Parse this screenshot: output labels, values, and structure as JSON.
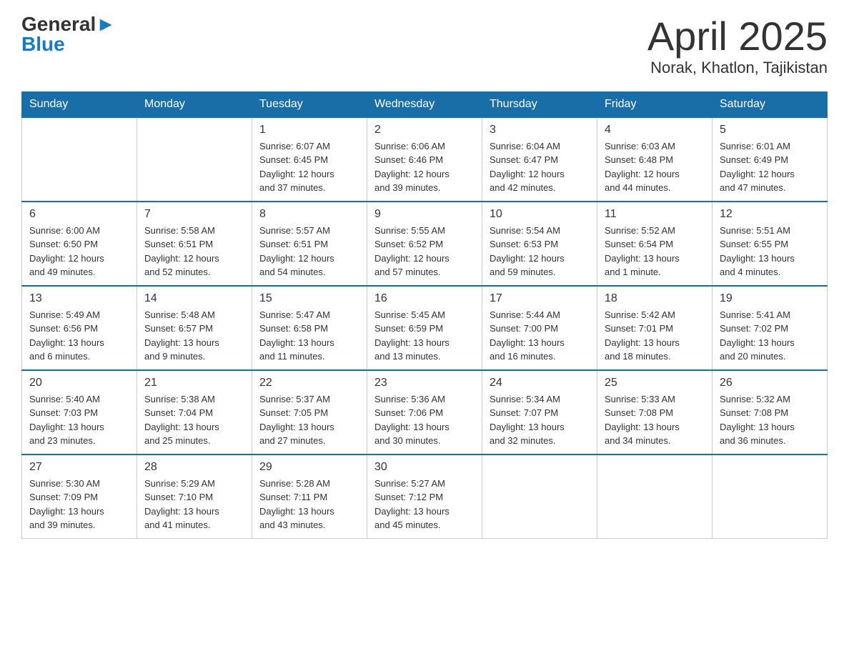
{
  "header": {
    "logo": {
      "line1": "General",
      "line2": "Blue",
      "arrow": "▶"
    },
    "month": "April 2025",
    "location": "Norak, Khatlon, Tajikistan"
  },
  "weekdays": [
    "Sunday",
    "Monday",
    "Tuesday",
    "Wednesday",
    "Thursday",
    "Friday",
    "Saturday"
  ],
  "weeks": [
    [
      {
        "day": "",
        "info": ""
      },
      {
        "day": "",
        "info": ""
      },
      {
        "day": "1",
        "info": "Sunrise: 6:07 AM\nSunset: 6:45 PM\nDaylight: 12 hours\nand 37 minutes."
      },
      {
        "day": "2",
        "info": "Sunrise: 6:06 AM\nSunset: 6:46 PM\nDaylight: 12 hours\nand 39 minutes."
      },
      {
        "day": "3",
        "info": "Sunrise: 6:04 AM\nSunset: 6:47 PM\nDaylight: 12 hours\nand 42 minutes."
      },
      {
        "day": "4",
        "info": "Sunrise: 6:03 AM\nSunset: 6:48 PM\nDaylight: 12 hours\nand 44 minutes."
      },
      {
        "day": "5",
        "info": "Sunrise: 6:01 AM\nSunset: 6:49 PM\nDaylight: 12 hours\nand 47 minutes."
      }
    ],
    [
      {
        "day": "6",
        "info": "Sunrise: 6:00 AM\nSunset: 6:50 PM\nDaylight: 12 hours\nand 49 minutes."
      },
      {
        "day": "7",
        "info": "Sunrise: 5:58 AM\nSunset: 6:51 PM\nDaylight: 12 hours\nand 52 minutes."
      },
      {
        "day": "8",
        "info": "Sunrise: 5:57 AM\nSunset: 6:51 PM\nDaylight: 12 hours\nand 54 minutes."
      },
      {
        "day": "9",
        "info": "Sunrise: 5:55 AM\nSunset: 6:52 PM\nDaylight: 12 hours\nand 57 minutes."
      },
      {
        "day": "10",
        "info": "Sunrise: 5:54 AM\nSunset: 6:53 PM\nDaylight: 12 hours\nand 59 minutes."
      },
      {
        "day": "11",
        "info": "Sunrise: 5:52 AM\nSunset: 6:54 PM\nDaylight: 13 hours\nand 1 minute."
      },
      {
        "day": "12",
        "info": "Sunrise: 5:51 AM\nSunset: 6:55 PM\nDaylight: 13 hours\nand 4 minutes."
      }
    ],
    [
      {
        "day": "13",
        "info": "Sunrise: 5:49 AM\nSunset: 6:56 PM\nDaylight: 13 hours\nand 6 minutes."
      },
      {
        "day": "14",
        "info": "Sunrise: 5:48 AM\nSunset: 6:57 PM\nDaylight: 13 hours\nand 9 minutes."
      },
      {
        "day": "15",
        "info": "Sunrise: 5:47 AM\nSunset: 6:58 PM\nDaylight: 13 hours\nand 11 minutes."
      },
      {
        "day": "16",
        "info": "Sunrise: 5:45 AM\nSunset: 6:59 PM\nDaylight: 13 hours\nand 13 minutes."
      },
      {
        "day": "17",
        "info": "Sunrise: 5:44 AM\nSunset: 7:00 PM\nDaylight: 13 hours\nand 16 minutes."
      },
      {
        "day": "18",
        "info": "Sunrise: 5:42 AM\nSunset: 7:01 PM\nDaylight: 13 hours\nand 18 minutes."
      },
      {
        "day": "19",
        "info": "Sunrise: 5:41 AM\nSunset: 7:02 PM\nDaylight: 13 hours\nand 20 minutes."
      }
    ],
    [
      {
        "day": "20",
        "info": "Sunrise: 5:40 AM\nSunset: 7:03 PM\nDaylight: 13 hours\nand 23 minutes."
      },
      {
        "day": "21",
        "info": "Sunrise: 5:38 AM\nSunset: 7:04 PM\nDaylight: 13 hours\nand 25 minutes."
      },
      {
        "day": "22",
        "info": "Sunrise: 5:37 AM\nSunset: 7:05 PM\nDaylight: 13 hours\nand 27 minutes."
      },
      {
        "day": "23",
        "info": "Sunrise: 5:36 AM\nSunset: 7:06 PM\nDaylight: 13 hours\nand 30 minutes."
      },
      {
        "day": "24",
        "info": "Sunrise: 5:34 AM\nSunset: 7:07 PM\nDaylight: 13 hours\nand 32 minutes."
      },
      {
        "day": "25",
        "info": "Sunrise: 5:33 AM\nSunset: 7:08 PM\nDaylight: 13 hours\nand 34 minutes."
      },
      {
        "day": "26",
        "info": "Sunrise: 5:32 AM\nSunset: 7:08 PM\nDaylight: 13 hours\nand 36 minutes."
      }
    ],
    [
      {
        "day": "27",
        "info": "Sunrise: 5:30 AM\nSunset: 7:09 PM\nDaylight: 13 hours\nand 39 minutes."
      },
      {
        "day": "28",
        "info": "Sunrise: 5:29 AM\nSunset: 7:10 PM\nDaylight: 13 hours\nand 41 minutes."
      },
      {
        "day": "29",
        "info": "Sunrise: 5:28 AM\nSunset: 7:11 PM\nDaylight: 13 hours\nand 43 minutes."
      },
      {
        "day": "30",
        "info": "Sunrise: 5:27 AM\nSunset: 7:12 PM\nDaylight: 13 hours\nand 45 minutes."
      },
      {
        "day": "",
        "info": ""
      },
      {
        "day": "",
        "info": ""
      },
      {
        "day": "",
        "info": ""
      }
    ]
  ]
}
